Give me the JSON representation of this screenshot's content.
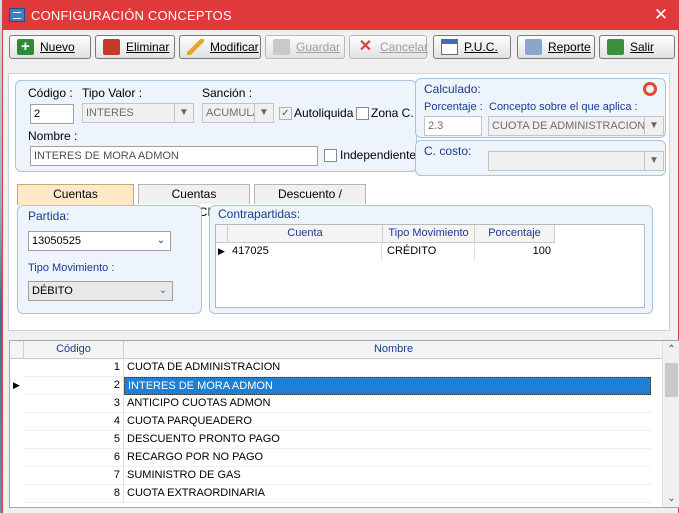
{
  "window": {
    "title": "CONFIGURACIÓN CONCEPTOS",
    "close": "✕"
  },
  "toolbar": {
    "new": "Nuevo",
    "delete": "Eliminar",
    "edit": "Modificar",
    "save": "Guardar",
    "cancel": "Cancelar",
    "puc": "P.U.C.",
    "report": "Reporte",
    "exit": "Salir"
  },
  "form": {
    "codigo_label": "Código :",
    "codigo_value": "2",
    "tipo_valor_label": "Tipo Valor :",
    "tipo_valor_value": "INTERES",
    "sancion_label": "Sanción :",
    "sancion_value": "ACUMULA",
    "autoliquida_label": "Autoliquida",
    "zona_label": "Zona C.",
    "nombre_label": "Nombre :",
    "nombre_value": "INTERES DE MORA ADMON",
    "independiente_label": "Independiente"
  },
  "calculado": {
    "title": "Calculado:",
    "porcentaje_label": "Porcentaje :",
    "porcentaje_value": "2.3",
    "concepto_label": "Concepto sobre el que aplica :",
    "concepto_value": "CUOTA DE ADMINISTRACION"
  },
  "costo": {
    "title": "C. costo:",
    "value": ""
  },
  "tabs": [
    "Cuentas CAUSACIÓN",
    "Cuentas EJECUCIÓN",
    "Descuento / Recargo"
  ],
  "partida": {
    "title": "Partida:",
    "value": "13050525",
    "tipo_mov_label": "Tipo Movimiento :",
    "tipo_mov_value": "DÉBITO"
  },
  "contrapartidas": {
    "title": "Contrapartidas:",
    "columns": [
      "Cuenta",
      "Tipo Movimiento",
      "Porcentaje"
    ],
    "rows": [
      {
        "cuenta": "417025",
        "tipo": "CRÉDITO",
        "porcentaje": "100"
      }
    ]
  },
  "conceptos_grid": {
    "columns": [
      "Código",
      "Nombre"
    ],
    "rows": [
      {
        "codigo": "1",
        "nombre": "CUOTA DE ADMINISTRACION"
      },
      {
        "codigo": "2",
        "nombre": "INTERES DE MORA ADMON"
      },
      {
        "codigo": "3",
        "nombre": "ANTICIPO CUOTAS ADMON"
      },
      {
        "codigo": "4",
        "nombre": "CUOTA PARQUEADERO"
      },
      {
        "codigo": "5",
        "nombre": "DESCUENTO PRONTO PAGO"
      },
      {
        "codigo": "6",
        "nombre": "RECARGO POR NO PAGO"
      },
      {
        "codigo": "7",
        "nombre": "SUMINISTRO DE GAS"
      },
      {
        "codigo": "8",
        "nombre": "CUOTA EXTRAORDINARIA"
      }
    ],
    "selected_index": 1
  },
  "colors": {
    "titlebar": "#e0393b",
    "selection": "#1c80d6",
    "label_blue": "#1a3b8c",
    "active_tab": "#fde9c8"
  }
}
